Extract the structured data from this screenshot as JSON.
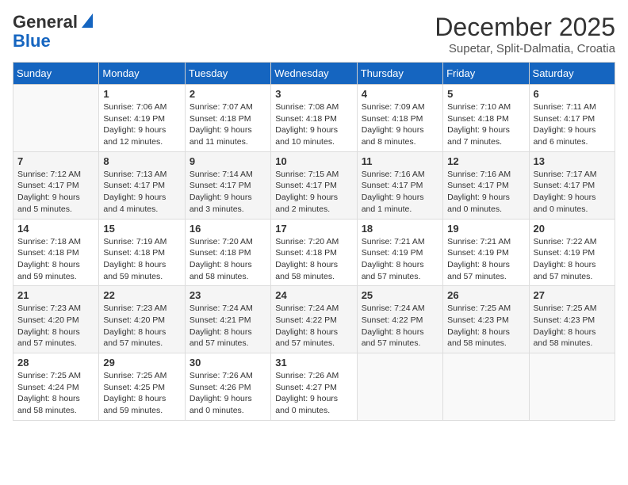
{
  "logo": {
    "general": "General",
    "blue": "Blue"
  },
  "title": "December 2025",
  "subtitle": "Supetar, Split-Dalmatia, Croatia",
  "days_of_week": [
    "Sunday",
    "Monday",
    "Tuesday",
    "Wednesday",
    "Thursday",
    "Friday",
    "Saturday"
  ],
  "weeks": [
    [
      {
        "day": "",
        "info": ""
      },
      {
        "day": "1",
        "info": "Sunrise: 7:06 AM\nSunset: 4:19 PM\nDaylight: 9 hours\nand 12 minutes."
      },
      {
        "day": "2",
        "info": "Sunrise: 7:07 AM\nSunset: 4:18 PM\nDaylight: 9 hours\nand 11 minutes."
      },
      {
        "day": "3",
        "info": "Sunrise: 7:08 AM\nSunset: 4:18 PM\nDaylight: 9 hours\nand 10 minutes."
      },
      {
        "day": "4",
        "info": "Sunrise: 7:09 AM\nSunset: 4:18 PM\nDaylight: 9 hours\nand 8 minutes."
      },
      {
        "day": "5",
        "info": "Sunrise: 7:10 AM\nSunset: 4:18 PM\nDaylight: 9 hours\nand 7 minutes."
      },
      {
        "day": "6",
        "info": "Sunrise: 7:11 AM\nSunset: 4:17 PM\nDaylight: 9 hours\nand 6 minutes."
      }
    ],
    [
      {
        "day": "7",
        "info": "Sunrise: 7:12 AM\nSunset: 4:17 PM\nDaylight: 9 hours\nand 5 minutes."
      },
      {
        "day": "8",
        "info": "Sunrise: 7:13 AM\nSunset: 4:17 PM\nDaylight: 9 hours\nand 4 minutes."
      },
      {
        "day": "9",
        "info": "Sunrise: 7:14 AM\nSunset: 4:17 PM\nDaylight: 9 hours\nand 3 minutes."
      },
      {
        "day": "10",
        "info": "Sunrise: 7:15 AM\nSunset: 4:17 PM\nDaylight: 9 hours\nand 2 minutes."
      },
      {
        "day": "11",
        "info": "Sunrise: 7:16 AM\nSunset: 4:17 PM\nDaylight: 9 hours\nand 1 minute."
      },
      {
        "day": "12",
        "info": "Sunrise: 7:16 AM\nSunset: 4:17 PM\nDaylight: 9 hours\nand 0 minutes."
      },
      {
        "day": "13",
        "info": "Sunrise: 7:17 AM\nSunset: 4:17 PM\nDaylight: 9 hours\nand 0 minutes."
      }
    ],
    [
      {
        "day": "14",
        "info": "Sunrise: 7:18 AM\nSunset: 4:18 PM\nDaylight: 8 hours\nand 59 minutes."
      },
      {
        "day": "15",
        "info": "Sunrise: 7:19 AM\nSunset: 4:18 PM\nDaylight: 8 hours\nand 59 minutes."
      },
      {
        "day": "16",
        "info": "Sunrise: 7:20 AM\nSunset: 4:18 PM\nDaylight: 8 hours\nand 58 minutes."
      },
      {
        "day": "17",
        "info": "Sunrise: 7:20 AM\nSunset: 4:18 PM\nDaylight: 8 hours\nand 58 minutes."
      },
      {
        "day": "18",
        "info": "Sunrise: 7:21 AM\nSunset: 4:19 PM\nDaylight: 8 hours\nand 57 minutes."
      },
      {
        "day": "19",
        "info": "Sunrise: 7:21 AM\nSunset: 4:19 PM\nDaylight: 8 hours\nand 57 minutes."
      },
      {
        "day": "20",
        "info": "Sunrise: 7:22 AM\nSunset: 4:19 PM\nDaylight: 8 hours\nand 57 minutes."
      }
    ],
    [
      {
        "day": "21",
        "info": "Sunrise: 7:23 AM\nSunset: 4:20 PM\nDaylight: 8 hours\nand 57 minutes."
      },
      {
        "day": "22",
        "info": "Sunrise: 7:23 AM\nSunset: 4:20 PM\nDaylight: 8 hours\nand 57 minutes."
      },
      {
        "day": "23",
        "info": "Sunrise: 7:24 AM\nSunset: 4:21 PM\nDaylight: 8 hours\nand 57 minutes."
      },
      {
        "day": "24",
        "info": "Sunrise: 7:24 AM\nSunset: 4:22 PM\nDaylight: 8 hours\nand 57 minutes."
      },
      {
        "day": "25",
        "info": "Sunrise: 7:24 AM\nSunset: 4:22 PM\nDaylight: 8 hours\nand 57 minutes."
      },
      {
        "day": "26",
        "info": "Sunrise: 7:25 AM\nSunset: 4:23 PM\nDaylight: 8 hours\nand 58 minutes."
      },
      {
        "day": "27",
        "info": "Sunrise: 7:25 AM\nSunset: 4:23 PM\nDaylight: 8 hours\nand 58 minutes."
      }
    ],
    [
      {
        "day": "28",
        "info": "Sunrise: 7:25 AM\nSunset: 4:24 PM\nDaylight: 8 hours\nand 58 minutes."
      },
      {
        "day": "29",
        "info": "Sunrise: 7:25 AM\nSunset: 4:25 PM\nDaylight: 8 hours\nand 59 minutes."
      },
      {
        "day": "30",
        "info": "Sunrise: 7:26 AM\nSunset: 4:26 PM\nDaylight: 9 hours\nand 0 minutes."
      },
      {
        "day": "31",
        "info": "Sunrise: 7:26 AM\nSunset: 4:27 PM\nDaylight: 9 hours\nand 0 minutes."
      },
      {
        "day": "",
        "info": ""
      },
      {
        "day": "",
        "info": ""
      },
      {
        "day": "",
        "info": ""
      }
    ]
  ]
}
